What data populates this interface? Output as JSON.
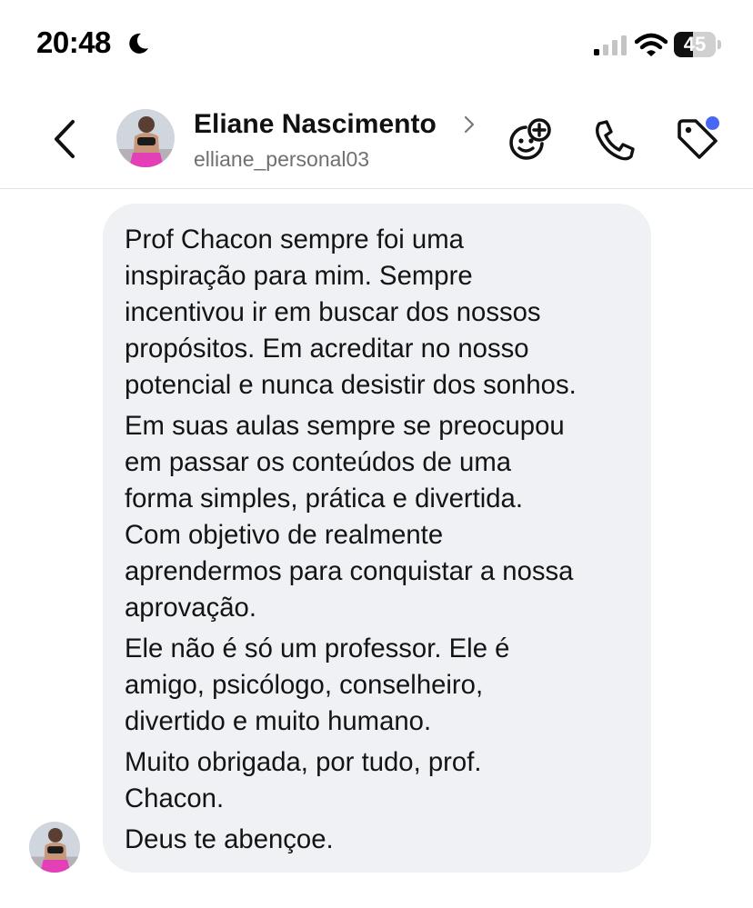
{
  "status_bar": {
    "time": "20:48",
    "battery_level": "45",
    "battery_fraction": 0.45,
    "icons": [
      "moon-icon",
      "signal-icon",
      "wifi-icon",
      "battery-icon"
    ]
  },
  "header": {
    "name": "Eliane Nascimento",
    "username": "elliane_personal03",
    "icons": [
      "back-icon",
      "avatar",
      "game-icon",
      "call-icon",
      "tag-icon"
    ],
    "notification_dot_color": "#4a66f5"
  },
  "message": {
    "paragraphs": [
      [
        "Prof Chacon sempre foi uma",
        "inspiração para mim. Sempre",
        "incentivou ir em buscar dos nossos",
        "propósitos. Em acreditar no nosso",
        "potencial e nunca desistir dos sonhos."
      ],
      [
        "Em suas aulas sempre se preocupou",
        "em passar os conteúdos de uma",
        "forma simples, prática e divertida.",
        "Com objetivo de realmente",
        "aprendermos para conquistar a nossa",
        "aprovação."
      ],
      [
        "Ele não é só um professor. Ele é",
        "amigo, psicólogo, conselheiro,",
        "divertido e muito humano."
      ],
      [
        "Muito obrigada, por tudo, prof.",
        "Chacon."
      ],
      [
        "Deus te abençoe."
      ]
    ],
    "bubble_color": "#eff1f4"
  }
}
